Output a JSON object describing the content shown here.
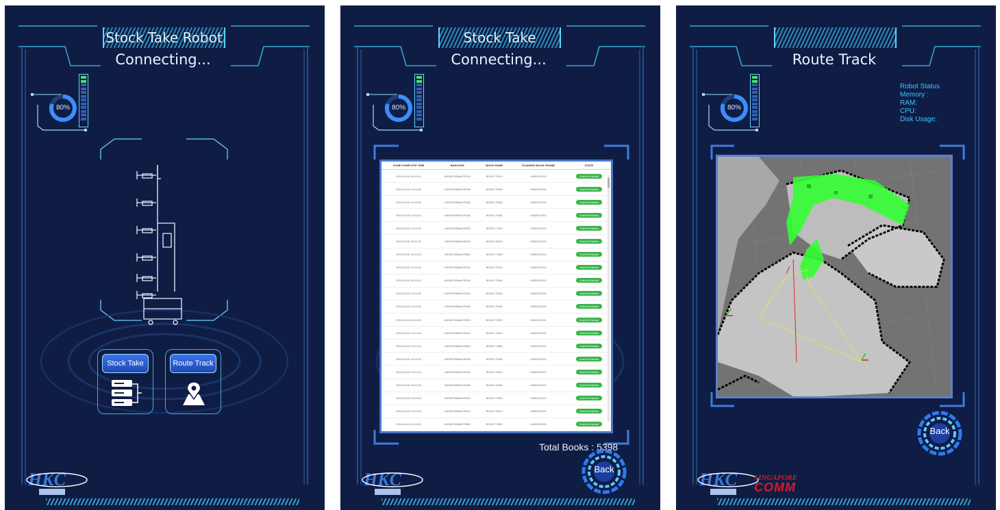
{
  "panels": {
    "home": {
      "title": "Stock Take Robot",
      "status": "Connecting...",
      "battery": "80%",
      "buttons": {
        "stock_take": "Stock Take",
        "route_track": "Route Track"
      }
    },
    "stock": {
      "title": "Stock Take",
      "status": "Connecting...",
      "battery": "80%",
      "table": {
        "columns": [
          "DONE COMPLETE TIME",
          "BARCODE",
          "BOOK NAME",
          "SCANNED BOOK FRAME",
          "STATE"
        ],
        "rows": [
          [
            "2019-04-26 14:14:01",
            "e304679309a479130",
            "BOOK 79130",
            "K06091C201",
            "Correct Position"
          ],
          [
            "2019-04-26 14:14:01",
            "e304679309a478106",
            "BOOK 79106",
            "K06091C201",
            "Correct Position"
          ],
          [
            "2019-04-26 14:14:01",
            "e304679309a479163",
            "BOOK 79163",
            "K06091C201",
            "Correct Position"
          ],
          [
            "2019-04-26 14:14:01",
            "e304679309a479166",
            "BOOK 79166",
            "K06091C201",
            "Correct Position"
          ],
          [
            "2019-04-26 14:14:01",
            "e304679309a479200",
            "BOOK 71200",
            "K06091C201",
            "Correct Position"
          ],
          [
            "2019-04-26 14:14:01",
            "e304679309a478410",
            "BOOK 78410",
            "K06091C201",
            "Correct Position"
          ],
          [
            "2019-04-26 14:14:01",
            "e304679309a479360",
            "BOOK 71360",
            "K06091C201",
            "Correct Position"
          ],
          [
            "2019-04-26 14:14:01",
            "e304679309a479130",
            "BOOK 79130",
            "K06091C201",
            "Correct Position"
          ],
          [
            "2019-04-26 14:14:01",
            "e304679309a478106",
            "BOOK 79106",
            "K06091C201",
            "Correct Position"
          ],
          [
            "2019-04-26 14:14:01",
            "e304679309a479163",
            "BOOK 79163",
            "K06091C201",
            "Correct Position"
          ],
          [
            "2019-04-26 14:14:01",
            "e304679309a479166",
            "BOOK 79166",
            "K06091C201",
            "Correct Position"
          ],
          [
            "2019-04-26 14:14:01",
            "e304679309a479200",
            "BOOK 71200",
            "K06091C201",
            "Correct Position"
          ],
          [
            "2019-04-26 14:14:01",
            "e304679309a478410",
            "BOOK 78410",
            "K06091C201",
            "Correct Position"
          ],
          [
            "2019-04-26 14:14:01",
            "e304679309a479360",
            "BOOK 71360",
            "K06091C201",
            "Correct Position"
          ],
          [
            "2019-04-26 14:14:01",
            "e304679309a478106",
            "BOOK 79106",
            "K06091C201",
            "Correct Position"
          ],
          [
            "2019-04-26 14:14:01",
            "e304679309a479163",
            "BOOK 79163",
            "K06091C201",
            "Correct Position"
          ],
          [
            "2019-04-26 14:14:01",
            "e304679309a479166",
            "BOOK 79166",
            "K06091C201",
            "Correct Position"
          ],
          [
            "2019-04-26 14:14:01",
            "e304679309a479200",
            "BOOK 71200",
            "K06091C201",
            "Correct Position"
          ],
          [
            "2019-04-26 14:14:01",
            "e304679309a478410",
            "BOOK 78410",
            "K06091C201",
            "Correct Position"
          ],
          [
            "2019-04-26 14:14:01",
            "e304679309a479360",
            "BOOK 71360",
            "K06091C201",
            "Correct Position"
          ]
        ]
      },
      "total_books": "Total Books : 5398",
      "back": "Back"
    },
    "route": {
      "title": "Route Track",
      "battery": "80%",
      "robot_status": [
        "Robot Status",
        "Memory :",
        "RAM:",
        "CPU:",
        "Disk Usage:"
      ],
      "back": "Back",
      "partner_logo": [
        "SINGAPORE",
        "COMM"
      ]
    }
  },
  "colors": {
    "panel_bg": "#0f1d45",
    "accent": "#4fc8ff",
    "button": "#2f5fd6",
    "ok_green": "#39b54a"
  }
}
